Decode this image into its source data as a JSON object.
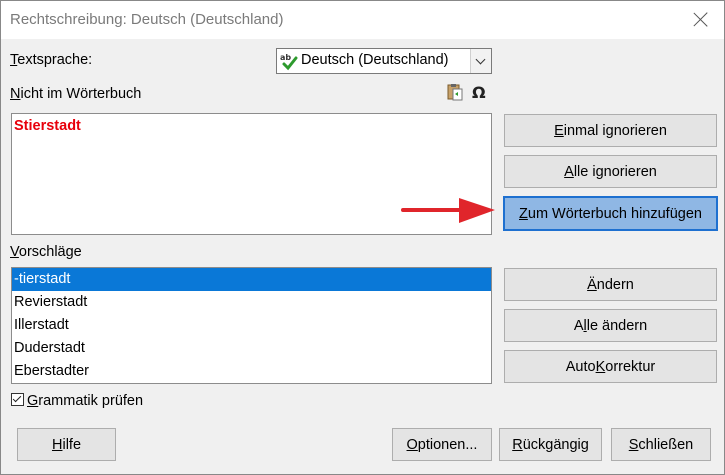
{
  "window": {
    "title": "Rechtschreibung: Deutsch (Deutschland)"
  },
  "language": {
    "label_first": "T",
    "label_rest": "extsprache:",
    "value": "Deutsch (Deutschland)"
  },
  "not_in_dict": {
    "label_first": "N",
    "label_rest": "icht im Wörterbuch",
    "word": "Stierstadt"
  },
  "suggestions": {
    "label_first": "V",
    "label_rest": "orschläge",
    "items": [
      "-tierstadt",
      "Revierstadt",
      "Illerstadt",
      "Duderstadt",
      "Eberstadter"
    ]
  },
  "buttons": {
    "ignore_once": {
      "pre": "",
      "u": "E",
      "post": "inmal ignorieren"
    },
    "ignore_all": {
      "pre": "",
      "u": "A",
      "post": "lle ignorieren"
    },
    "add_to_dict": {
      "pre": "",
      "u": "Z",
      "post": "um Wörterbuch hinzufügen"
    },
    "change": {
      "pre": "",
      "u": "Ä",
      "post": "ndern"
    },
    "change_all": {
      "pre": "A",
      "u": "l",
      "post": "le ändern"
    },
    "autocorrect": {
      "pre": "Auto",
      "u": "K",
      "post": "orrektur"
    },
    "help": {
      "pre": "",
      "u": "H",
      "post": "ilfe"
    },
    "options": {
      "pre": "",
      "u": "O",
      "post": "ptionen..."
    },
    "undo": {
      "pre": "",
      "u": "R",
      "post": "ückgängig"
    },
    "close": {
      "pre": "",
      "u": "S",
      "post": "chließen"
    }
  },
  "grammar": {
    "label_first": "G",
    "label_rest": "rammatik prüfen",
    "checked": true
  },
  "colors": {
    "accent": "#1e70d0",
    "selection": "#0a78d7",
    "error_word": "#e8000b",
    "arrow": "#e0252b"
  },
  "icons": {
    "lang": "spellcheck-abc-icon",
    "paste": "paste-icon",
    "special_char": "omega-icon",
    "close": "close-icon"
  }
}
